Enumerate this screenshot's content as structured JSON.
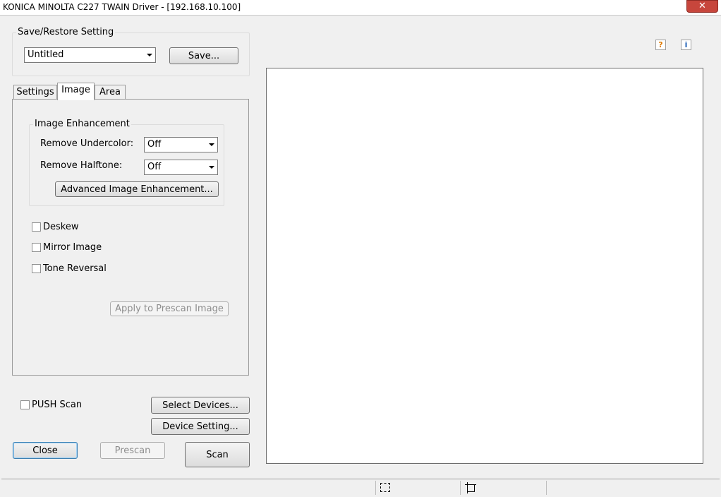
{
  "window": {
    "title": "KONICA MINOLTA C227 TWAIN Driver - [192.168.10.100]",
    "close_glyph": "✕"
  },
  "save_restore": {
    "title": "Save/Restore Setting",
    "selected": "Untitled",
    "save_label": "Save..."
  },
  "help_icons": {
    "help_glyph": "?",
    "info_glyph": "i"
  },
  "tabs": [
    {
      "label": "Settings"
    },
    {
      "label": "Image"
    },
    {
      "label": "Area"
    }
  ],
  "image_enhancement": {
    "title": "Image Enhancement",
    "remove_undercolor_label": "Remove Undercolor:",
    "remove_undercolor_value": "Off",
    "remove_halftone_label": "Remove Halftone:",
    "remove_halftone_value": "Off",
    "advanced_label": "Advanced Image Enhancement..."
  },
  "options": {
    "deskew": "Deskew",
    "mirror": "Mirror Image",
    "tone": "Tone Reversal",
    "apply_label": "Apply to Prescan Image"
  },
  "bottom": {
    "push_scan": "PUSH Scan",
    "select_devices": "Select Devices...",
    "device_setting": "Device Setting...",
    "close": "Close",
    "prescan": "Prescan",
    "scan": "Scan"
  },
  "statusbar": {
    "icons": [
      "select-area-icon",
      "crop-area-icon"
    ]
  }
}
